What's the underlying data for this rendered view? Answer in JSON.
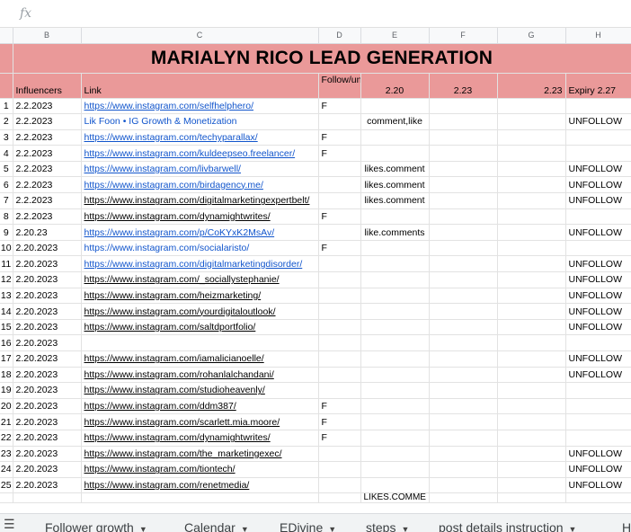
{
  "formula_bar": {
    "icon": "fx",
    "value": ""
  },
  "columns": [
    "B",
    "C",
    "D",
    "E",
    "F",
    "G",
    "H"
  ],
  "title": "MARIALYN RICO LEAD GENERATION",
  "headers": {
    "influencers": "Influencers",
    "link": "Link",
    "follow": "Follow/unfollow",
    "e": "2.20",
    "f": "2.23",
    "g": "2.23",
    "h": "Expiry 2.27"
  },
  "rows": [
    {
      "n": "1",
      "date": "2.2.2023",
      "link": "https://www.instagram.com/selfhelphero/",
      "blue": true,
      "follow": "F",
      "e": "",
      "h": ""
    },
    {
      "n": "2",
      "date": "2.2.2023",
      "link": "Lik Foon • IG Growth & Monetization",
      "blue": true,
      "nounderline": true,
      "follow": "",
      "e": "comment,like",
      "h": "UNFOLLOW"
    },
    {
      "n": "3",
      "date": "2.2.2023",
      "link": "https://www.instagram.com/techyparallax/",
      "blue": true,
      "follow": "F",
      "e": "",
      "h": ""
    },
    {
      "n": "4",
      "date": "2.2.2023",
      "link": "https://www.instagram.com/kuldeepseo.freelancer/",
      "blue": true,
      "follow": "F",
      "e": "",
      "h": ""
    },
    {
      "n": "5",
      "date": "2.2.2023",
      "link": "https://www.instagram.com/livbarwell/",
      "blue": true,
      "follow": "",
      "e": "likes.comment",
      "h": "UNFOLLOW"
    },
    {
      "n": "6",
      "date": "2.2.2023",
      "link": "https://www.instagram.com/birdagency.me/",
      "blue": true,
      "follow": "",
      "e": "likes.comment",
      "h": "UNFOLLOW"
    },
    {
      "n": "7",
      "date": "2.2.2023",
      "link": "https://www.instagram.com/digitalmarketingexpertbelt/",
      "blue": false,
      "follow": "",
      "e": "likes.comment",
      "h": "UNFOLLOW"
    },
    {
      "n": "8",
      "date": "2.2.2023",
      "link": "https://www.instagram.com/dynamightwrites/",
      "blue": false,
      "follow": "F",
      "e": "",
      "h": ""
    },
    {
      "n": "9",
      "date": "2.20.23",
      "link": "https://www.instagram.com/p/CoKYxK2MsAv/",
      "blue": true,
      "follow": "",
      "e": "like.comments",
      "h": "UNFOLLOW"
    },
    {
      "n": "10",
      "date": "2.20.2023",
      "link": "https://www.instagram.com/socialaristo/",
      "blue": true,
      "nounderline": true,
      "follow": "F",
      "e": "",
      "h": ""
    },
    {
      "n": "11",
      "date": "2.20.2023",
      "link": "https://www.instagram.com/digitalmarketingdisorder/",
      "blue": true,
      "follow": "",
      "e": "",
      "h": "UNFOLLOW"
    },
    {
      "n": "12",
      "date": "2.20.2023",
      "link": "https://www.instagram.com/_sociallystephanie/",
      "blue": false,
      "follow": "",
      "e": "",
      "h": "UNFOLLOW"
    },
    {
      "n": "13",
      "date": "2.20.2023",
      "link": "https://www.instagram.com/heizmarketing/",
      "blue": false,
      "follow": "",
      "e": "",
      "h": "UNFOLLOW"
    },
    {
      "n": "14",
      "date": "2.20.2023",
      "link": "https://www.instagram.com/yourdigitaloutlook/",
      "blue": false,
      "follow": "",
      "e": "",
      "h": "UNFOLLOW"
    },
    {
      "n": "15",
      "date": "2.20.2023",
      "link": "https://www.instagram.com/saltdportfolio/",
      "blue": false,
      "follow": "",
      "e": "",
      "h": "UNFOLLOW"
    },
    {
      "n": "16",
      "date": "2.20.2023",
      "link": "",
      "blue": false,
      "follow": "",
      "e": "",
      "h": ""
    },
    {
      "n": "17",
      "date": "2.20.2023",
      "link": "https://www.instagram.com/iamalicianoelle/",
      "blue": false,
      "follow": "",
      "e": "",
      "h": "UNFOLLOW"
    },
    {
      "n": "18",
      "date": "2.20.2023",
      "link": "https://www.instagram.com/rohanlalchandani/",
      "blue": false,
      "follow": "",
      "e": "",
      "h": "UNFOLLOW"
    },
    {
      "n": "19",
      "date": "2.20.2023",
      "link": "https://www.instagram.com/studioheavenly/",
      "blue": false,
      "follow": "",
      "e": "",
      "h": ""
    },
    {
      "n": "20",
      "date": "2.20.2023",
      "link": "https://www.instagram.com/ddm387/",
      "blue": false,
      "follow": "F",
      "e": "",
      "h": ""
    },
    {
      "n": "21",
      "date": "2.20.2023",
      "link": "https://www.instagram.com/scarlett.mia.moore/",
      "blue": false,
      "follow": "F",
      "e": "",
      "h": ""
    },
    {
      "n": "22",
      "date": "2.20.2023",
      "link": "https://www.instagram.com/dynamightwrites/",
      "blue": false,
      "follow": "F",
      "e": "",
      "h": ""
    },
    {
      "n": "23",
      "date": "2.20.2023",
      "link": "https://www.instagram.com/the_marketingexec/",
      "blue": false,
      "follow": "",
      "e": "",
      "h": "UNFOLLOW"
    },
    {
      "n": "24",
      "date": "2.20.2023",
      "link": "https://www.instagram.com/tiontech/",
      "blue": false,
      "follow": "",
      "e": "",
      "h": "UNFOLLOW"
    },
    {
      "n": "25",
      "date": "2.20.2023",
      "link": "https://www.instagram.com/renetmedia/",
      "blue": false,
      "follow": "",
      "e": "",
      "h": "UNFOLLOW"
    }
  ],
  "partial_row": {
    "e": "LIKES.COMME"
  },
  "sheet_tabs": [
    {
      "label": "Follower growth"
    },
    {
      "label": "Calendar"
    },
    {
      "label": "EDivine"
    },
    {
      "label": "steps"
    },
    {
      "label": "post details instruction"
    },
    {
      "label": "H"
    }
  ],
  "colors": {
    "header_fill": "#ea9999",
    "link_blue": "#1155cc"
  }
}
